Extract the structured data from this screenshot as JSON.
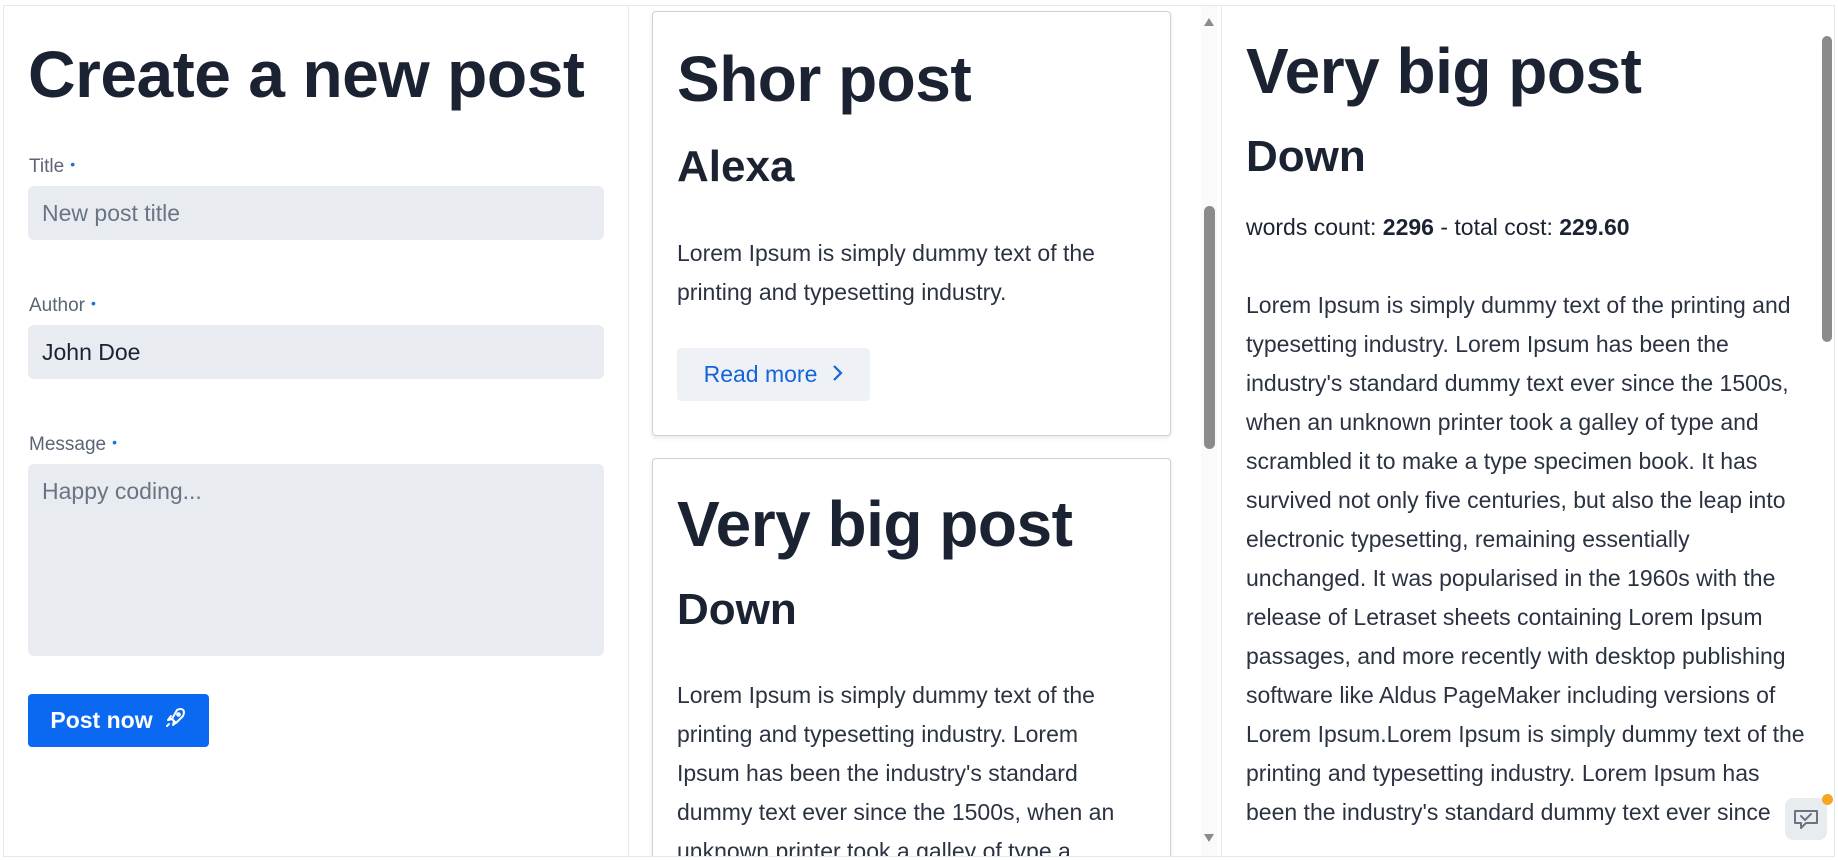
{
  "form": {
    "heading": "Create a new post",
    "title_label": "Title",
    "title_placeholder": "New post title",
    "author_label": "Author",
    "author_value": "John Doe",
    "message_label": "Message",
    "message_placeholder": "Happy coding...",
    "required_marker": "•",
    "submit_label": "Post now"
  },
  "feed": {
    "posts": [
      {
        "title": "Shor post",
        "author": "Alexa",
        "excerpt": "Lorem Ipsum is simply dummy text of the printing and typesetting industry.",
        "read_more": "Read more"
      },
      {
        "title": "Very big post",
        "author": "Down",
        "excerpt": "Lorem Ipsum is simply dummy text of the printing and typesetting industry. Lorem Ipsum has been the industry's standard dummy text ever since the 1500s, when an unknown printer took a galley of type a..."
      }
    ]
  },
  "detail": {
    "title": "Very big post",
    "author": "Down",
    "words_label": "words count:",
    "words_count": "2296",
    "separator": "-",
    "cost_label": "total cost:",
    "total_cost": "229.60",
    "body": "Lorem Ipsum is simply dummy text of the printing and typesetting industry. Lorem Ipsum has been the industry's standard dummy text ever since the 1500s, when an unknown printer took a galley of type and scrambled it to make a type specimen book. It has survived not only five centuries, but also the leap into electronic typesetting, remaining essentially unchanged. It was popularised in the 1960s with the release of Letraset sheets containing Lorem Ipsum passages, and more recently with desktop publishing software like Aldus PageMaker including versions of Lorem Ipsum.Lorem Ipsum is simply dummy text of the printing and typesetting industry. Lorem Ipsum has been the industry's standard dummy text ever since"
  },
  "icons": {
    "submit": "rocket-icon",
    "read_more": "chevron-right-icon",
    "scroll_up": "arrow-up-icon",
    "scroll_down": "arrow-down-icon",
    "chat": "chat-widget-icon"
  },
  "colors": {
    "primary": "#0b68f0",
    "link": "#1565d8",
    "input_bg": "#e8ebf0",
    "heading": "#1b2333",
    "notification": "#f5a623"
  }
}
